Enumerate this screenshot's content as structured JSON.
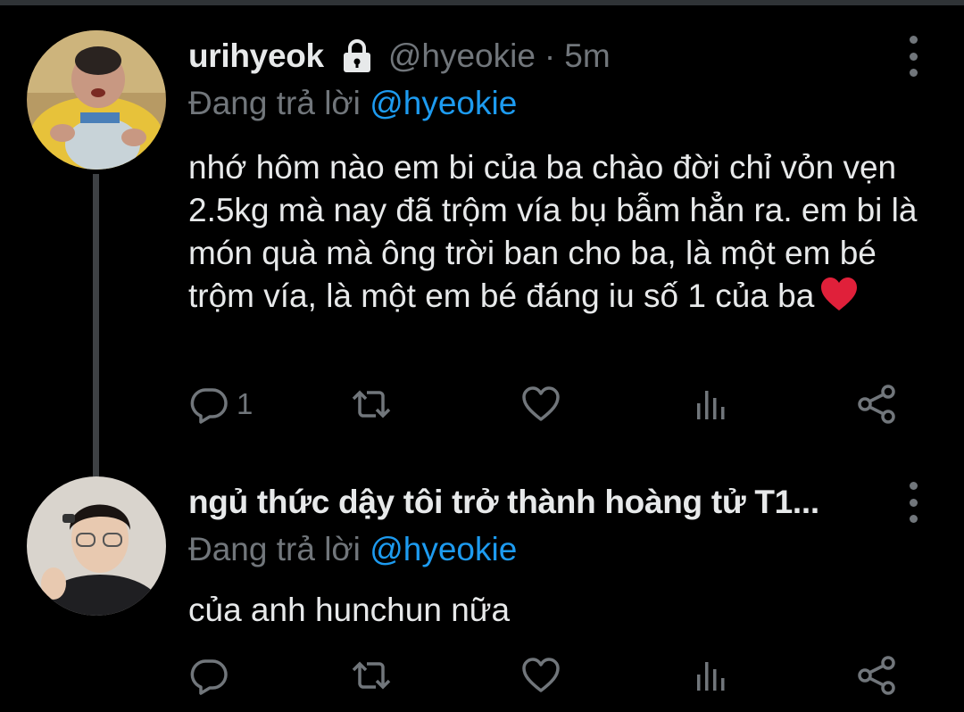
{
  "colors": {
    "background": "#000000",
    "text": "#e7e9ea",
    "muted": "#71767b",
    "mention": "#1d9bf0",
    "thread_line": "#3e4144"
  },
  "tweets": [
    {
      "display_name": "urihyeok",
      "protected_icon": "lock-icon",
      "handle": "@hyeokie",
      "dot": "·",
      "time": "5m",
      "replying_prefix": "Đang trả lời",
      "replying_to": "@hyeokie",
      "text": "nhớ hôm nào em bi của ba chào đời chỉ vỏn vẹn 2.5kg mà nay đã trộm vía bụ bẫm hẳn ra. em bi là món quà mà ông trời ban cho ba, là một em bé trộm vía, là một em bé đáng iu số 1 của ba",
      "emoji": "red-heart-emoji",
      "reply_count": "1"
    },
    {
      "display_name": "ngủ thức dậy tôi trở thành hoàng tử T1...",
      "replying_prefix": "Đang trả lời",
      "replying_to": "@hyeokie",
      "text": "của anh hunchun nữa",
      "reply_count": ""
    }
  ]
}
